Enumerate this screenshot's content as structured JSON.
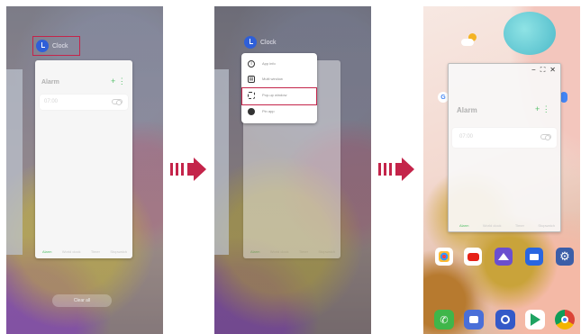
{
  "app": {
    "name": "Clock"
  },
  "alarm": {
    "title": "Alarm",
    "time": "07:00",
    "add_symbol": "+ ⋮"
  },
  "tabs": [
    "Alarm",
    "World clock",
    "Timer",
    "Stopwatch"
  ],
  "recents": {
    "clear_all_label": "Clear all"
  },
  "menu": {
    "items": [
      {
        "label": "App info",
        "icon": "info-icon"
      },
      {
        "label": "Multi window",
        "icon": "multi-window-icon"
      },
      {
        "label": "Pop-up window",
        "icon": "popup-window-icon"
      },
      {
        "label": "Pin app",
        "icon": "pin-icon"
      }
    ]
  },
  "popup": {
    "controls": [
      "−",
      "⛶",
      "✕"
    ]
  },
  "colors": {
    "highlight": "#c4244a",
    "clock_blue": "#2f5fd8",
    "accent_green": "#55c06a"
  },
  "home": {
    "app_icons": [
      "apps-folder-icon",
      "youtube-icon",
      "gallery-icon",
      "video-icon",
      "settings-icon"
    ],
    "dock": [
      "phone-icon",
      "messages-icon",
      "camera-icon",
      "play-store-icon",
      "chrome-icon"
    ]
  }
}
